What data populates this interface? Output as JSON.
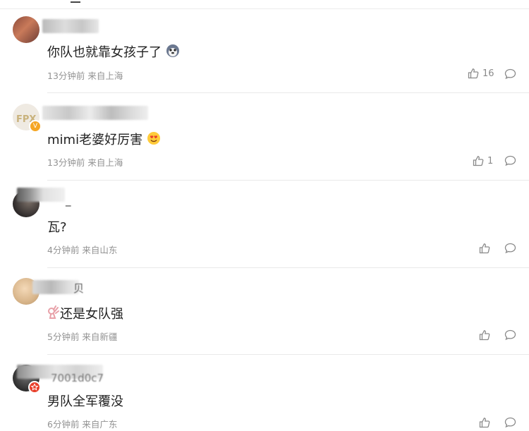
{
  "comments": [
    {
      "text": "你队也就靠女孩子了",
      "time_location": "13分钟前 来自上海",
      "likes": "16",
      "trailing_emoji": "husky-emoji"
    },
    {
      "text": "mimi老婆好厉害",
      "time_location": "13分钟前 来自上海",
      "likes": "1",
      "trailing_emoji": "heart-eyes-emoji",
      "verified_badge": "V"
    },
    {
      "name_suffix": "_",
      "text": "瓦?",
      "time_location": "4分钟前 来自山东",
      "likes": ""
    },
    {
      "name_suffix": "贝",
      "text": "还是女队强",
      "time_location": "5分钟前 来自新疆",
      "likes": "",
      "leading_emoji": "ok-hand-emoji"
    },
    {
      "name_suffix": "7001d0c7",
      "text": "男队全军覆没",
      "time_location": "6分钟前 来自广东",
      "likes": ""
    }
  ],
  "colors": {
    "verified_badge": "#f5a623",
    "red_badge": "#e8402c",
    "divider": "#e9e9e9",
    "meta": "#939393"
  }
}
